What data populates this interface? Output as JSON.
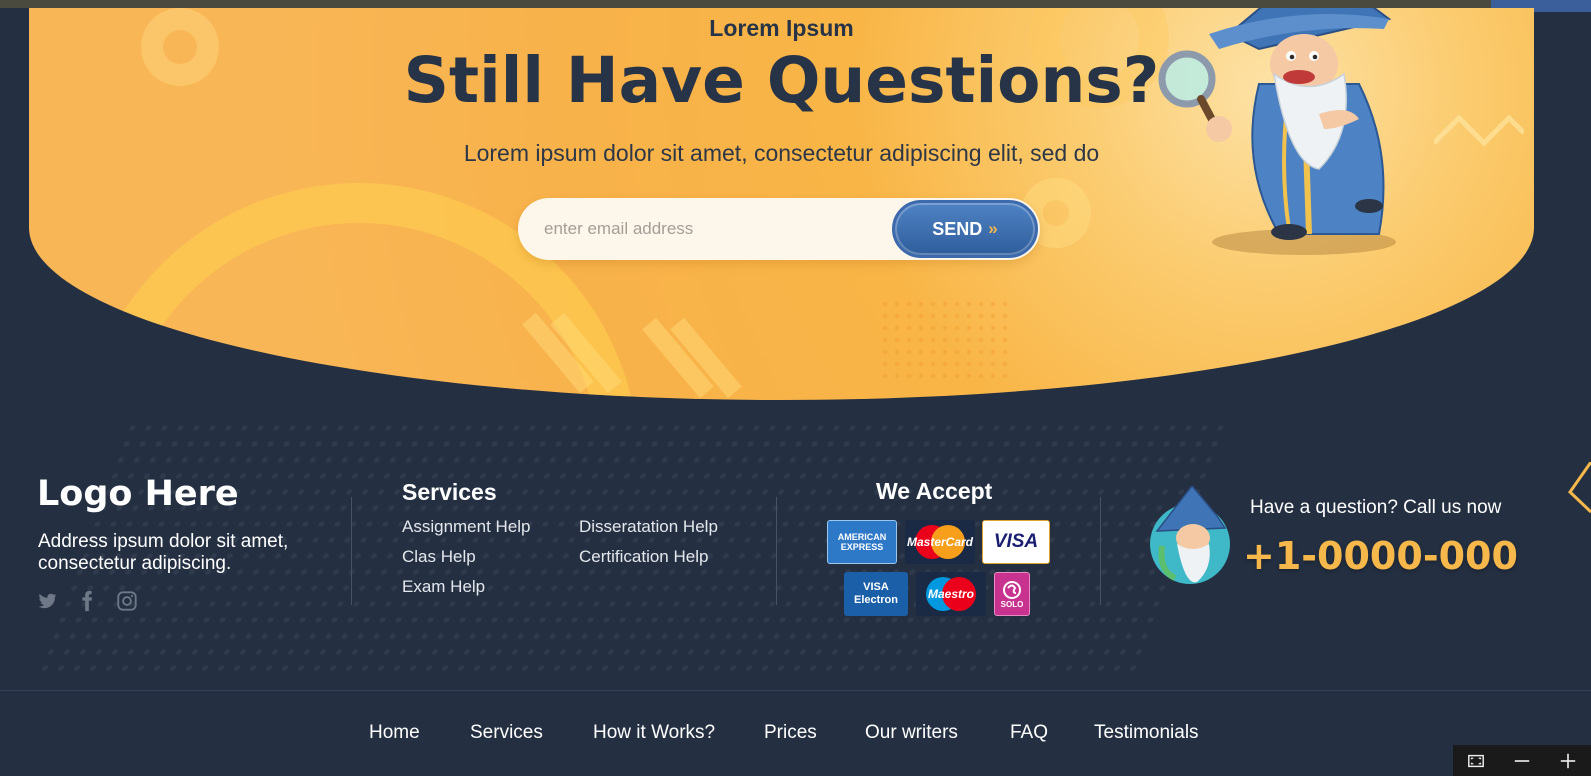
{
  "hero": {
    "eyebrow": "Lorem Ipsum",
    "title": "Still Have Questions?",
    "subtitle": "Lorem ipsum dolor sit amet, consectetur adipiscing elit, sed do",
    "email_placeholder": "enter email address",
    "send_label": "SEND",
    "send_icon": "double-chevron-right-icon"
  },
  "footer": {
    "logo": "Logo Here",
    "address": "Address ipsum dolor sit amet, consectetur adipiscing.",
    "socials": [
      "twitter-icon",
      "facebook-icon",
      "instagram-icon"
    ],
    "services": {
      "title": "Services",
      "links": [
        "Assignment Help",
        "Disseratation Help",
        "Clas Help",
        "Certification Help",
        "Exam Help"
      ]
    },
    "accept": {
      "title": "We Accept",
      "cards": [
        {
          "label": "AMERICAN EXPRESS",
          "color": "#2e78c8"
        },
        {
          "label": "MasterCard",
          "color": "#eb001b"
        },
        {
          "label": "VISA",
          "color": "#1a1f71"
        },
        {
          "label": "VISA Electron",
          "color": "#1a5fa8"
        },
        {
          "label": "Maestro",
          "color": "#0099df"
        },
        {
          "label": "SOLO",
          "color": "#c8338f"
        }
      ]
    },
    "call": {
      "label": "Have a question? Call us now",
      "number": "+1-0000-000"
    }
  },
  "nav": {
    "items": [
      "Home",
      "Services",
      "How it Works?",
      "Prices",
      "Our writers",
      "FAQ",
      "Testimonials"
    ]
  },
  "zoom_controls": [
    "fit-screen-icon",
    "zoom-out-icon",
    "zoom-in-icon"
  ],
  "colors": {
    "background": "#243042",
    "hero": "#f8b24a",
    "accent": "#f7b84b",
    "button": "#3a6db0",
    "heading": "#273447"
  }
}
